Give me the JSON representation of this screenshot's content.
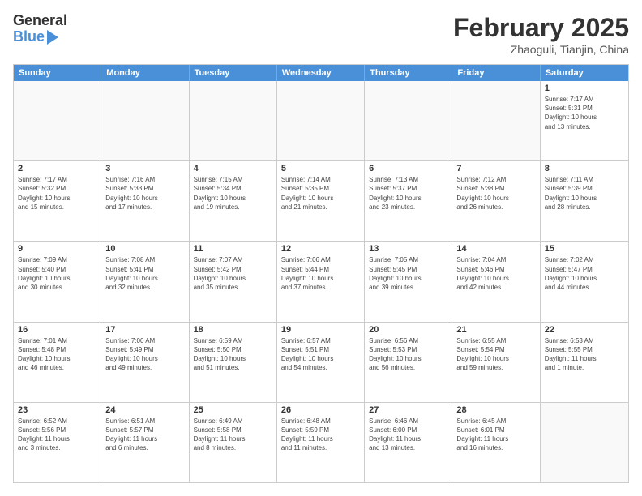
{
  "header": {
    "logo_main": "General",
    "logo_sub": "Blue",
    "month": "February 2025",
    "location": "Zhaoguli, Tianjin, China"
  },
  "weekdays": [
    "Sunday",
    "Monday",
    "Tuesday",
    "Wednesday",
    "Thursday",
    "Friday",
    "Saturday"
  ],
  "rows": [
    [
      {
        "day": "",
        "info": ""
      },
      {
        "day": "",
        "info": ""
      },
      {
        "day": "",
        "info": ""
      },
      {
        "day": "",
        "info": ""
      },
      {
        "day": "",
        "info": ""
      },
      {
        "day": "",
        "info": ""
      },
      {
        "day": "1",
        "info": "Sunrise: 7:17 AM\nSunset: 5:31 PM\nDaylight: 10 hours\nand 13 minutes."
      }
    ],
    [
      {
        "day": "2",
        "info": "Sunrise: 7:17 AM\nSunset: 5:32 PM\nDaylight: 10 hours\nand 15 minutes."
      },
      {
        "day": "3",
        "info": "Sunrise: 7:16 AM\nSunset: 5:33 PM\nDaylight: 10 hours\nand 17 minutes."
      },
      {
        "day": "4",
        "info": "Sunrise: 7:15 AM\nSunset: 5:34 PM\nDaylight: 10 hours\nand 19 minutes."
      },
      {
        "day": "5",
        "info": "Sunrise: 7:14 AM\nSunset: 5:35 PM\nDaylight: 10 hours\nand 21 minutes."
      },
      {
        "day": "6",
        "info": "Sunrise: 7:13 AM\nSunset: 5:37 PM\nDaylight: 10 hours\nand 23 minutes."
      },
      {
        "day": "7",
        "info": "Sunrise: 7:12 AM\nSunset: 5:38 PM\nDaylight: 10 hours\nand 26 minutes."
      },
      {
        "day": "8",
        "info": "Sunrise: 7:11 AM\nSunset: 5:39 PM\nDaylight: 10 hours\nand 28 minutes."
      }
    ],
    [
      {
        "day": "9",
        "info": "Sunrise: 7:09 AM\nSunset: 5:40 PM\nDaylight: 10 hours\nand 30 minutes."
      },
      {
        "day": "10",
        "info": "Sunrise: 7:08 AM\nSunset: 5:41 PM\nDaylight: 10 hours\nand 32 minutes."
      },
      {
        "day": "11",
        "info": "Sunrise: 7:07 AM\nSunset: 5:42 PM\nDaylight: 10 hours\nand 35 minutes."
      },
      {
        "day": "12",
        "info": "Sunrise: 7:06 AM\nSunset: 5:44 PM\nDaylight: 10 hours\nand 37 minutes."
      },
      {
        "day": "13",
        "info": "Sunrise: 7:05 AM\nSunset: 5:45 PM\nDaylight: 10 hours\nand 39 minutes."
      },
      {
        "day": "14",
        "info": "Sunrise: 7:04 AM\nSunset: 5:46 PM\nDaylight: 10 hours\nand 42 minutes."
      },
      {
        "day": "15",
        "info": "Sunrise: 7:02 AM\nSunset: 5:47 PM\nDaylight: 10 hours\nand 44 minutes."
      }
    ],
    [
      {
        "day": "16",
        "info": "Sunrise: 7:01 AM\nSunset: 5:48 PM\nDaylight: 10 hours\nand 46 minutes."
      },
      {
        "day": "17",
        "info": "Sunrise: 7:00 AM\nSunset: 5:49 PM\nDaylight: 10 hours\nand 49 minutes."
      },
      {
        "day": "18",
        "info": "Sunrise: 6:59 AM\nSunset: 5:50 PM\nDaylight: 10 hours\nand 51 minutes."
      },
      {
        "day": "19",
        "info": "Sunrise: 6:57 AM\nSunset: 5:51 PM\nDaylight: 10 hours\nand 54 minutes."
      },
      {
        "day": "20",
        "info": "Sunrise: 6:56 AM\nSunset: 5:53 PM\nDaylight: 10 hours\nand 56 minutes."
      },
      {
        "day": "21",
        "info": "Sunrise: 6:55 AM\nSunset: 5:54 PM\nDaylight: 10 hours\nand 59 minutes."
      },
      {
        "day": "22",
        "info": "Sunrise: 6:53 AM\nSunset: 5:55 PM\nDaylight: 11 hours\nand 1 minute."
      }
    ],
    [
      {
        "day": "23",
        "info": "Sunrise: 6:52 AM\nSunset: 5:56 PM\nDaylight: 11 hours\nand 3 minutes."
      },
      {
        "day": "24",
        "info": "Sunrise: 6:51 AM\nSunset: 5:57 PM\nDaylight: 11 hours\nand 6 minutes."
      },
      {
        "day": "25",
        "info": "Sunrise: 6:49 AM\nSunset: 5:58 PM\nDaylight: 11 hours\nand 8 minutes."
      },
      {
        "day": "26",
        "info": "Sunrise: 6:48 AM\nSunset: 5:59 PM\nDaylight: 11 hours\nand 11 minutes."
      },
      {
        "day": "27",
        "info": "Sunrise: 6:46 AM\nSunset: 6:00 PM\nDaylight: 11 hours\nand 13 minutes."
      },
      {
        "day": "28",
        "info": "Sunrise: 6:45 AM\nSunset: 6:01 PM\nDaylight: 11 hours\nand 16 minutes."
      },
      {
        "day": "",
        "info": ""
      }
    ]
  ]
}
